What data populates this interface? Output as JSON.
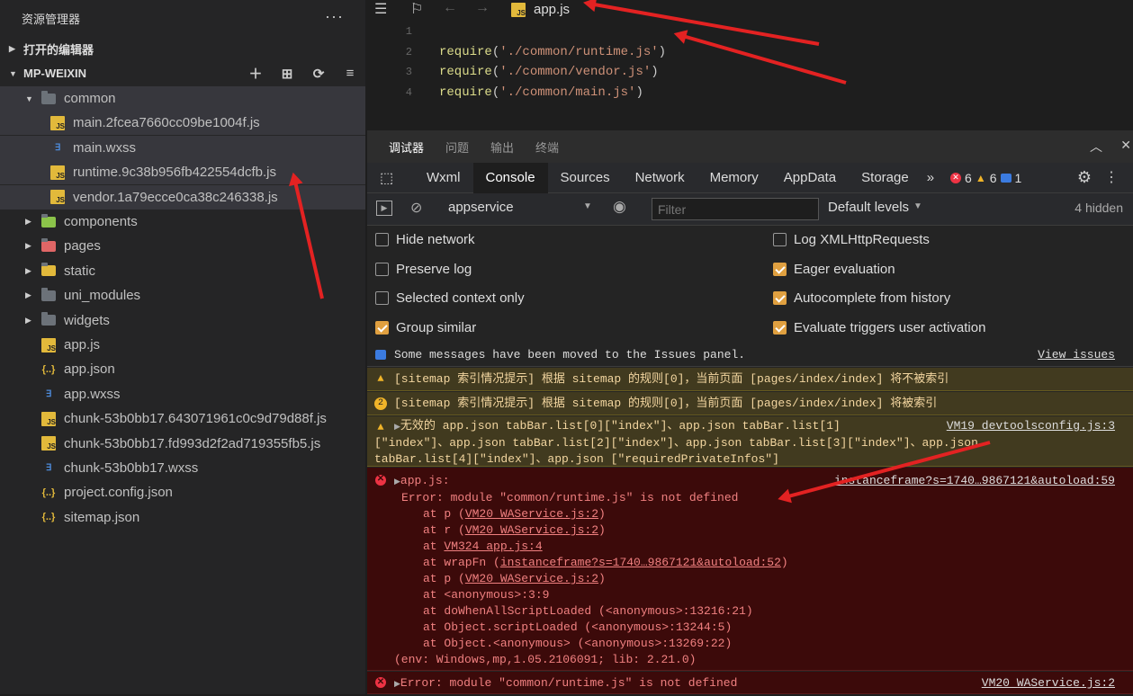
{
  "sidebar": {
    "title": "资源管理器",
    "more": "···",
    "open_editors": "打开的编辑器",
    "project": "MP-WEIXIN",
    "tree": [
      {
        "label": "common",
        "type": "folder",
        "level": 0,
        "expanded": true
      },
      {
        "label": "main.2fcea7660cc09be1004f.js",
        "type": "js",
        "level": 1
      },
      {
        "label": "main.wxss",
        "type": "css",
        "level": 1
      },
      {
        "label": "runtime.9c38b956fb422554dcfb.js",
        "type": "js",
        "level": 1
      },
      {
        "label": "vendor.1a79ecce0ca38c246338.js",
        "type": "js",
        "level": 1
      },
      {
        "label": "components",
        "type": "folder",
        "level": 0
      },
      {
        "label": "pages",
        "type": "folder",
        "level": 0
      },
      {
        "label": "static",
        "type": "folder",
        "level": 0
      },
      {
        "label": "uni_modules",
        "type": "folder",
        "level": 0
      },
      {
        "label": "widgets",
        "type": "folder",
        "level": 0
      },
      {
        "label": "app.js",
        "type": "js",
        "level": 0
      },
      {
        "label": "app.json",
        "type": "json",
        "level": 0
      },
      {
        "label": "app.wxss",
        "type": "css",
        "level": 0
      },
      {
        "label": "chunk-53b0bb17.643071961c0c9d79d88f.js",
        "type": "js",
        "level": 0
      },
      {
        "label": "chunk-53b0bb17.fd993d2f2ad719355fb5.js",
        "type": "js",
        "level": 0
      },
      {
        "label": "chunk-53b0bb17.wxss",
        "type": "css",
        "level": 0
      },
      {
        "label": "project.config.json",
        "type": "json",
        "level": 0
      },
      {
        "label": "sitemap.json",
        "type": "json",
        "level": 0
      }
    ]
  },
  "editor": {
    "tab": "app.js",
    "lines": [
      {
        "n": "1",
        "fn": "",
        "arg": ""
      },
      {
        "n": "2",
        "fn": "require",
        "arg": "'./common/runtime.js'"
      },
      {
        "n": "3",
        "fn": "require",
        "arg": "'./common/vendor.js'"
      },
      {
        "n": "4",
        "fn": "require",
        "arg": "'./common/main.js'"
      }
    ]
  },
  "devtools": {
    "tabs": [
      "调试器",
      "问题",
      "输出",
      "终端"
    ],
    "panels": [
      "Wxml",
      "Console",
      "Sources",
      "Network",
      "Memory",
      "AppData",
      "Storage"
    ],
    "more": "»",
    "err_count": "6",
    "warn_count": "6",
    "info_count": "1",
    "context": "appservice",
    "filter_placeholder": "Filter",
    "levels": "Default levels",
    "hidden": "4 hidden",
    "options_left": [
      "Hide network",
      "Preserve log",
      "Selected context only",
      "Group similar"
    ],
    "options_right": [
      "Log XMLHttpRequests",
      "Eager evaluation",
      "Autocomplete from history",
      "Evaluate triggers user activation"
    ],
    "msg_info": "Some messages have been moved to the Issues panel.",
    "msg_info_link": "View issues",
    "msg_warn1": "[sitemap 索引情况提示] 根据 sitemap 的规则[0]，当前页面 [pages/index/index] 将不被索引",
    "msg_warn2_count": "2",
    "msg_warn2": "[sitemap 索引情况提示] 根据 sitemap 的规则[0]，当前页面 [pages/index/index] 将被索引",
    "msg_warn3_a": "无效的 app.json tabBar.list[0][\"index\"]、app.json tabBar.list[1]",
    "msg_warn3_link": "VM19 devtoolsconfig.js:3",
    "msg_warn3_b": "[\"index\"]、app.json tabBar.list[2][\"index\"]、app.json tabBar.list[3][\"index\"]、app.json",
    "msg_warn3_c": "tabBar.list[4][\"index\"]、app.json [\"requiredPrivateInfos\"]",
    "err_head": "app.js:",
    "err_link": "instanceframe?s=1740…9867121&autoload:59",
    "err_msg": "Error: module \"common/runtime.js\" is not defined",
    "stack": [
      {
        "pre": "at p (",
        "link": "VM20 WAService.js:2",
        "post": ")"
      },
      {
        "pre": "at r (",
        "link": "VM20 WAService.js:2",
        "post": ")"
      },
      {
        "pre": "at ",
        "link": "VM324 app.js:4",
        "post": ""
      },
      {
        "pre": "at wrapFn (",
        "link": "instanceframe?s=1740…9867121&autoload:52",
        "post": ")"
      },
      {
        "pre": "at p (",
        "link": "VM20 WAService.js:2",
        "post": ")"
      },
      {
        "pre": "at <anonymous>:3:9",
        "link": "",
        "post": ""
      },
      {
        "pre": "at doWhenAllScriptLoaded (<anonymous>:13216:21)",
        "link": "",
        "post": ""
      },
      {
        "pre": "at Object.scriptLoaded (<anonymous>:13244:5)",
        "link": "",
        "post": ""
      },
      {
        "pre": "at Object.<anonymous> (<anonymous>:13269:22)",
        "link": "",
        "post": ""
      }
    ],
    "env": "(env: Windows,mp,1.05.2106091; lib: 2.21.0)",
    "err2": "Error: module \"common/runtime.js\" is not defined",
    "err2_link": "VM20 WAService.js:2"
  }
}
